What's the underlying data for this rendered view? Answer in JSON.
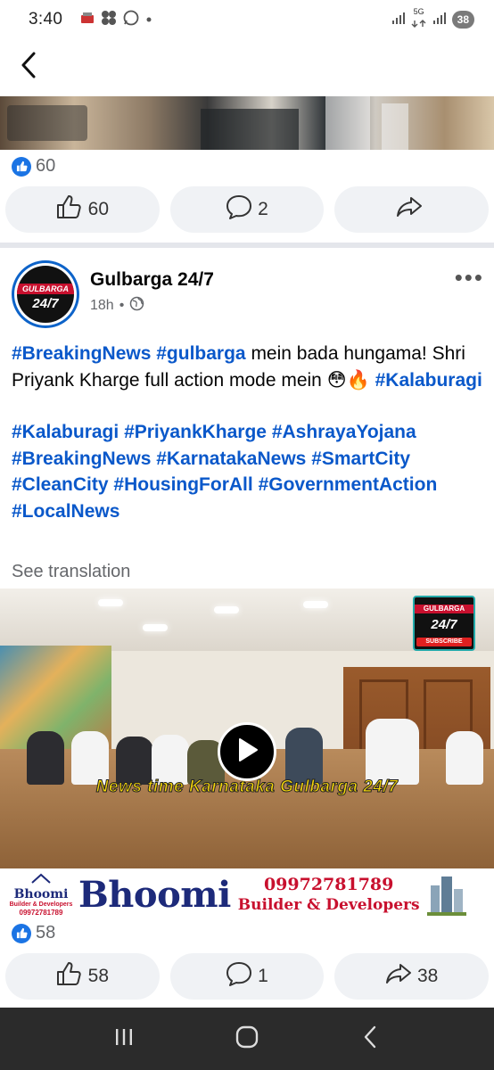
{
  "status_bar": {
    "time": "3:40",
    "network": "5G",
    "battery": "38",
    "notification_icons": [
      "indian-news-app-icon",
      "pinwheel-icon",
      "whatsapp-icon",
      "dot-icon"
    ]
  },
  "nav": {
    "back_icon": "chevron-left-icon"
  },
  "previous_post": {
    "reaction_count": "60",
    "actions": {
      "like": "60",
      "comment": "2",
      "share": ""
    }
  },
  "post": {
    "page_name": "Gulbarga 24/7",
    "avatar_band": "GULBARGA",
    "avatar_number": "24/7",
    "time": "18h",
    "audience_icon": "globe-icon",
    "text": {
      "line1_tag1": "#BreakingNews",
      "line1_tag2": "#gulbarga",
      "line1_text": " mein bada hungama! Shri Priyank Kharge full action mode mein ",
      "emoji1": "😳",
      "emoji2": "🔥",
      "line1_tag3": "#Kalaburagi",
      "tags": [
        "#Kalaburagi",
        "#PriyankKharge",
        "#AshrayaYojana",
        "#BreakingNews",
        "#KarnatakaNews",
        "#SmartCity",
        "#CleanCity",
        "#HousingForAll",
        "#GovernmentAction",
        "#LocalNews"
      ]
    },
    "see_translation": "See translation",
    "video": {
      "ticker": "News time Karnataka Gulbarga 24/7",
      "logo_band": "GULBARGA",
      "logo_number": "24/7",
      "logo_subscribe": "SUBSCRIBE"
    },
    "ad": {
      "small_name": "Bhoomi",
      "small_sub": "Builder & Developers",
      "small_phone": "09972781789",
      "big_name": "Bhoomi",
      "phone": "09972781789",
      "tagline": "Builder & Developers"
    },
    "reaction_count": "58",
    "actions": {
      "like": "58",
      "comment": "1",
      "share": "38"
    }
  },
  "colors": {
    "brand_blue": "#1b74e4",
    "hashtag_blue": "#0a58ca",
    "action_bg": "#f0f2f5",
    "ad_navy": "#1d2a7a",
    "ad_red": "#c8102e"
  }
}
